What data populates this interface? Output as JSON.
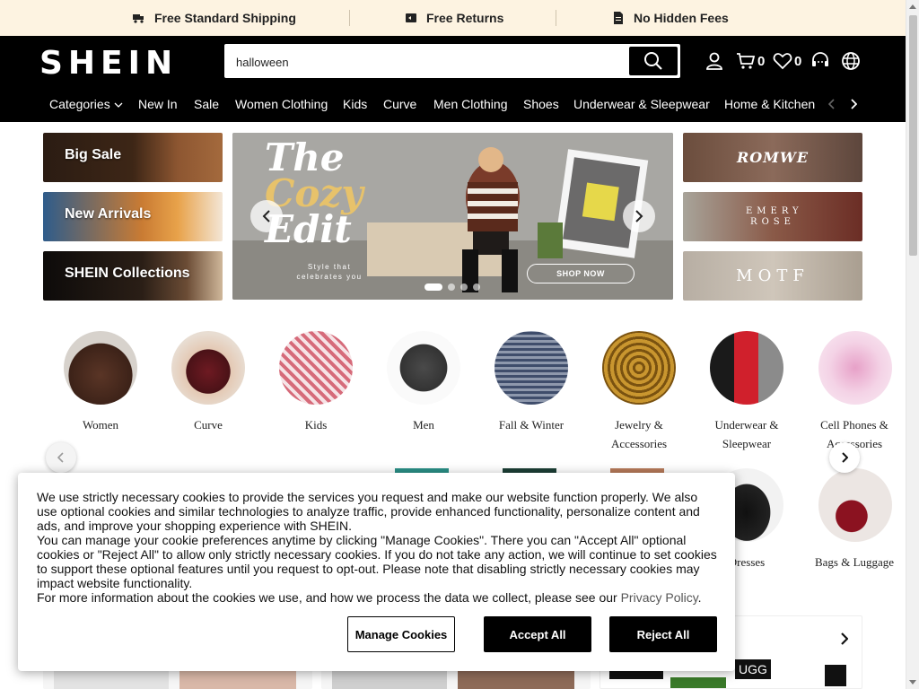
{
  "promo": {
    "items": [
      {
        "label": "Free Standard Shipping",
        "icon": "truck-icon"
      },
      {
        "label": "Free Returns",
        "icon": "return-icon"
      },
      {
        "label": "No Hidden Fees",
        "icon": "document-icon"
      }
    ]
  },
  "header": {
    "logo": "SHEIN",
    "search_value": "halloween",
    "cart_count": "0",
    "wishlist_count": "0",
    "nav": [
      "Categories",
      "New In",
      "Sale",
      "Women Clothing",
      "Kids",
      "Curve",
      "Men Clothing",
      "Shoes",
      "Underwear & Sleepwear",
      "Home & Kitchen"
    ]
  },
  "banners": {
    "left": [
      "Big Sale",
      "New Arrivals",
      "SHEIN Collections"
    ],
    "hero": {
      "title_line1": "The",
      "title_line2": "Cozy",
      "title_line3": "Edit",
      "subtitle": "Style that celebrates you",
      "cta": "SHOP NOW",
      "slide_count": 4,
      "active_slide": 1
    },
    "brands": [
      "ROMWE",
      "EMERY ROSE",
      "MOTF"
    ]
  },
  "categories": {
    "row1": [
      "Women",
      "Curve",
      "Kids",
      "Men",
      "Fall & Winter",
      "Jewelry & Accessories",
      "Underwear & Sleepwear",
      "Cell Phones & Accessories"
    ],
    "row2_visible": [
      "Dresses",
      "Bags & Luggage"
    ]
  },
  "strip": {
    "brand_badge": "UGG"
  },
  "cookie": {
    "para1": "We use strictly necessary cookies to provide the services you request and make our website function properly. We also use optional cookies and similar technologies to analyze traffic, provide enhanced functionality, personalize content and ads, and improve your shopping experience with SHEIN.",
    "para2": "You can manage your cookie preferences anytime by clicking \"Manage Cookies\". There you can \"Accept All\" optional cookies or \"Reject All\" to allow only strictly necessary cookies. If you do not take any action, we will continue to set cookies to support these optional features until you request to opt-out. Please note that disabling strictly necessary cookies may impact website functionality.",
    "para3_prefix": "For more information about the cookies we use, and how we process the data we collect, please see our ",
    "privacy_link": "Privacy Policy",
    "para3_suffix": ".",
    "manage_label": "Manage Cookies",
    "accept_label": "Accept All",
    "reject_label": "Reject All"
  }
}
